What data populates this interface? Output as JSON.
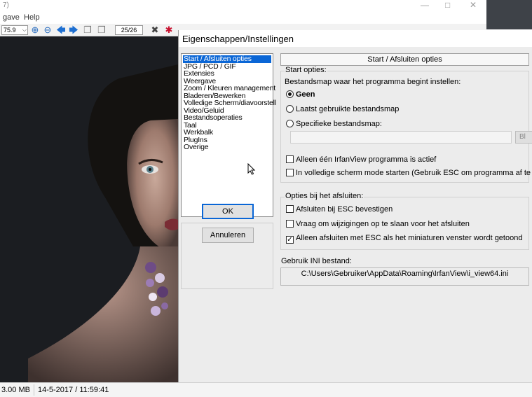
{
  "app": {
    "title_fragment": "7)",
    "menu": [
      "gave",
      "Help"
    ],
    "toolbar": {
      "zoom_value": "75.9",
      "page_counter": "25/26"
    },
    "status": {
      "size": "3.00 MB",
      "date": "14-5-2017 / 11:59:41"
    }
  },
  "dialog": {
    "title": "Eigenschappen/Instellingen",
    "categories": [
      "Start / Afsluiten opties",
      "JPG / PCD / GIF",
      "Extensies",
      "Weergave",
      "Zoom / Kleuren management",
      "Bladeren/Bewerken",
      "Volledige Scherm/diavoorstell",
      "Video/Geluid",
      "Bestandsoperaties",
      "Taal",
      "Werkbalk",
      "PlugIns",
      "Overige"
    ],
    "selected_category": "Start / Afsluiten opties",
    "ok_label": "OK",
    "cancel_label": "Annuleren",
    "panel_title": "Start / Afsluiten opties",
    "start_options": {
      "group_label": "Start opties:",
      "folder_label": "Bestandsmap waar het programma begint instellen:",
      "radio_none": "Geen",
      "radio_last": "Laatst gebruikte bestandsmap",
      "radio_specific": "Specifieke bestandsmap:",
      "browse_label": "Bl",
      "check_single_instance": "Alleen één IrfanView programma is actief",
      "check_fullscreen": "In volledige scherm mode starten (Gebruik ESC om programma af te sluiten)"
    },
    "exit_options": {
      "group_label": "Opties bij het afsluiten:",
      "check_confirm_esc": "Afsluiten bij ESC bevestigen",
      "check_ask_save": "Vraag om wijzigingen op te slaan voor het afsluiten",
      "check_esc_thumbnails": "Alleen afsluiten met ESC als het miniaturen venster wordt getoond"
    },
    "ini": {
      "label": "Gebruik INI bestand:",
      "path": "C:\\Users\\Gebruiker\\AppData\\Roaming\\IrfanView\\i_view64.ini"
    }
  },
  "colors": {
    "selection": "#0a66d6",
    "dialog_bg": "#ececec",
    "image_bg": "#1b1d21"
  }
}
